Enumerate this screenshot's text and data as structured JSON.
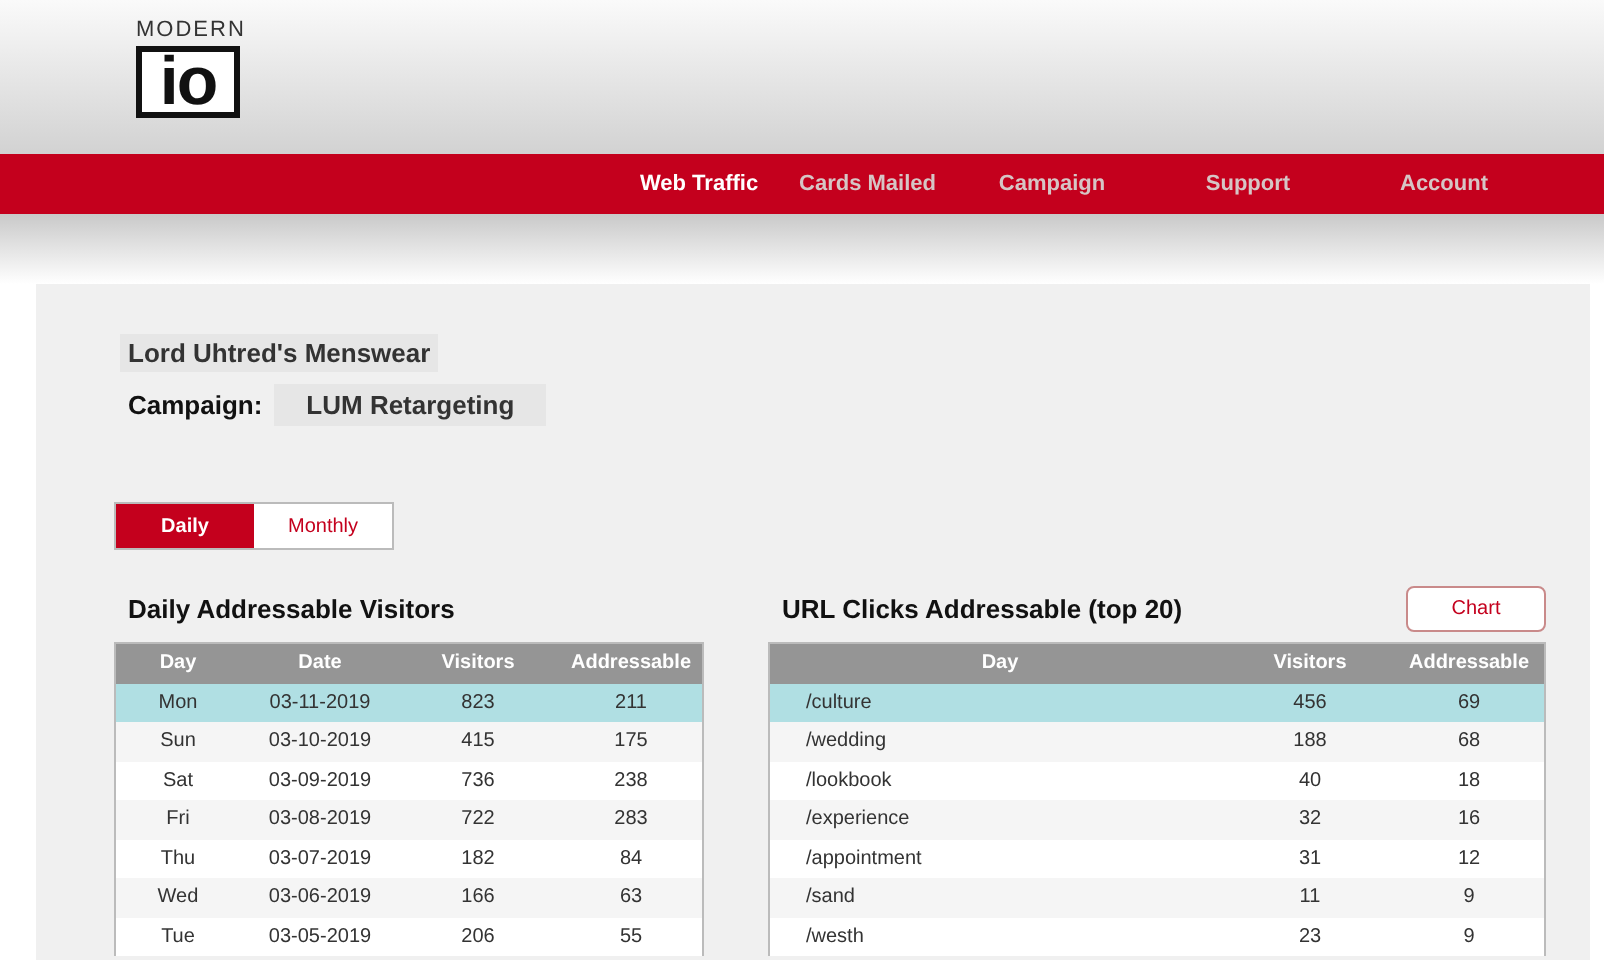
{
  "logo": {
    "top": "MODERN",
    "mark": "io"
  },
  "nav": [
    {
      "label": "Web Traffic",
      "selected": true
    },
    {
      "label": "Cards Mailed",
      "selected": false
    },
    {
      "label": "Campaign",
      "selected": false
    },
    {
      "label": "Support",
      "selected": false
    },
    {
      "label": "Account",
      "selected": false
    }
  ],
  "company": "Lord Uhtred's Menswear",
  "campaign": {
    "label": "Campaign:",
    "value": "LUM Retargeting"
  },
  "tabs": [
    {
      "label": "Daily",
      "selected": true
    },
    {
      "label": "Monthly",
      "selected": false
    }
  ],
  "daily_table": {
    "title": "Daily Addressable Visitors",
    "columns": [
      "Day",
      "Date",
      "Visitors",
      "Addressable"
    ],
    "rows": [
      {
        "cells": [
          "Mon",
          "03-11-2019",
          "823",
          "211"
        ],
        "selected": true
      },
      {
        "cells": [
          "Sun",
          "03-10-2019",
          "415",
          "175"
        ],
        "selected": false
      },
      {
        "cells": [
          "Sat",
          "03-09-2019",
          "736",
          "238"
        ],
        "selected": false
      },
      {
        "cells": [
          "Fri",
          "03-08-2019",
          "722",
          "283"
        ],
        "selected": false
      },
      {
        "cells": [
          "Thu",
          "03-07-2019",
          "182",
          "84"
        ],
        "selected": false
      },
      {
        "cells": [
          "Wed",
          "03-06-2019",
          "166",
          "63"
        ],
        "selected": false
      },
      {
        "cells": [
          "Tue",
          "03-05-2019",
          "206",
          "55"
        ],
        "selected": false
      }
    ]
  },
  "url_table": {
    "title": "URL Clicks Addressable (top 20)",
    "button": "Chart",
    "columns": [
      "Day",
      "Visitors",
      "Addressable"
    ],
    "rows": [
      {
        "cells": [
          "/culture",
          "456",
          "69"
        ],
        "selected": true
      },
      {
        "cells": [
          "/wedding",
          "188",
          "68"
        ],
        "selected": false
      },
      {
        "cells": [
          "/lookbook",
          "40",
          "18"
        ],
        "selected": false
      },
      {
        "cells": [
          "/experience",
          "32",
          "16"
        ],
        "selected": false
      },
      {
        "cells": [
          "/appointment",
          "31",
          "12"
        ],
        "selected": false
      },
      {
        "cells": [
          "/sand",
          "11",
          "9"
        ],
        "selected": false
      },
      {
        "cells": [
          "/westh",
          "23",
          "9"
        ],
        "selected": false
      }
    ]
  }
}
